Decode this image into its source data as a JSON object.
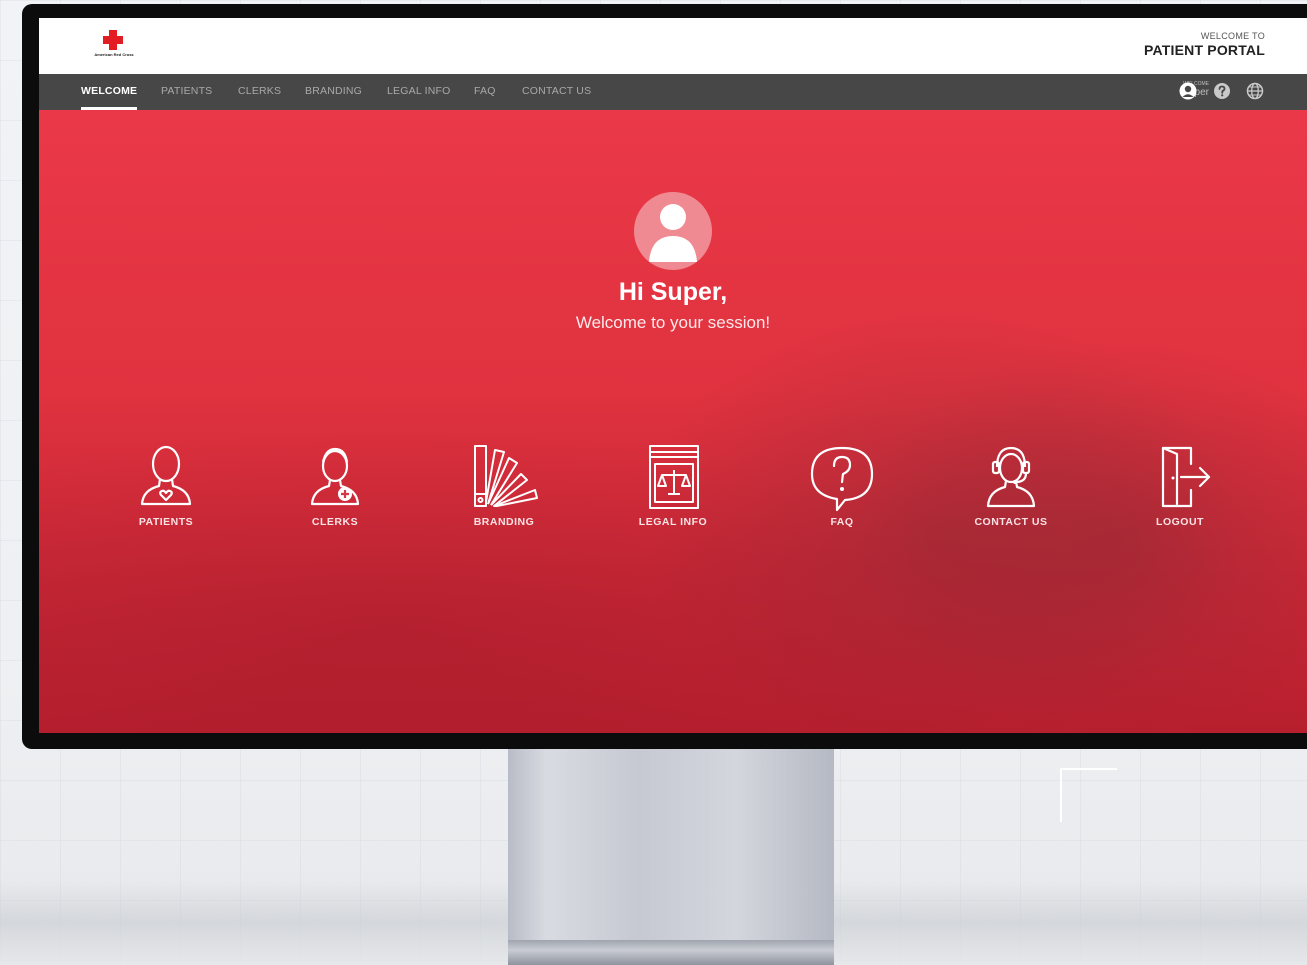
{
  "brand": {
    "logo_text": "American Red Cross",
    "accent_color": "#e31b23",
    "hero_color": "#e03342"
  },
  "header": {
    "welcome_small": "WELCOME TO",
    "portal_title": "PATIENT PORTAL"
  },
  "nav": {
    "items": [
      {
        "label": "WELCOME",
        "active": true
      },
      {
        "label": "PATIENTS",
        "active": false
      },
      {
        "label": "CLERKS",
        "active": false
      },
      {
        "label": "BRANDING",
        "active": false
      },
      {
        "label": "LEGAL INFO",
        "active": false
      },
      {
        "label": "FAQ",
        "active": false
      },
      {
        "label": "CONTACT US",
        "active": false
      }
    ],
    "user_small": "WELCOME",
    "user_name": "Super",
    "icons": [
      "user-avatar-icon",
      "help-icon",
      "globe-icon"
    ]
  },
  "hero": {
    "greeting": "Hi Super,",
    "subtitle": "Welcome to your session!",
    "tiles": [
      {
        "label": "PATIENTS",
        "icon": "patient-icon"
      },
      {
        "label": "CLERKS",
        "icon": "clerk-icon"
      },
      {
        "label": "BRANDING",
        "icon": "swatch-fan-icon"
      },
      {
        "label": "LEGAL INFO",
        "icon": "law-book-icon"
      },
      {
        "label": "FAQ",
        "icon": "question-bubble-icon"
      },
      {
        "label": "CONTACT US",
        "icon": "headset-icon"
      },
      {
        "label": "LOGOUT",
        "icon": "door-exit-icon"
      }
    ]
  }
}
